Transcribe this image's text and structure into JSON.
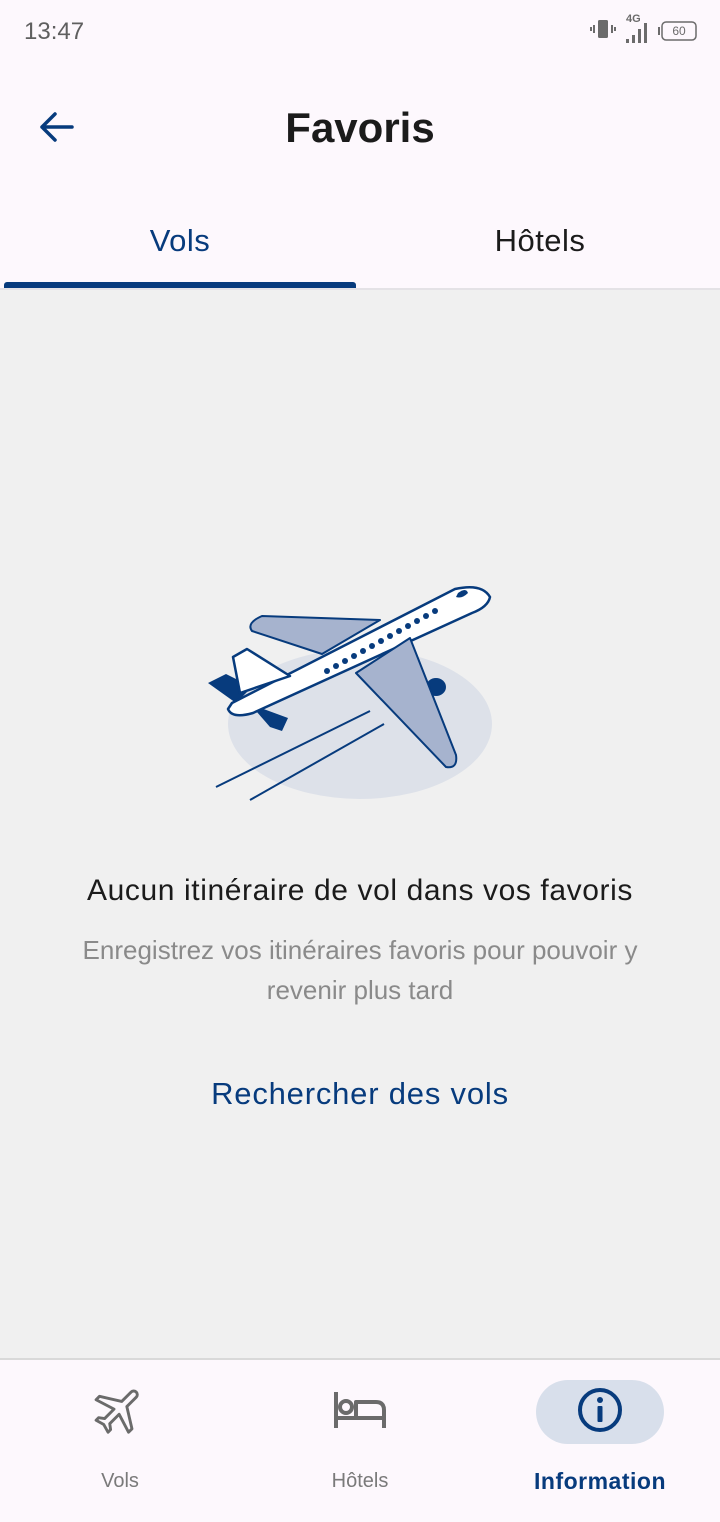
{
  "status_bar": {
    "time": "13:47",
    "network": "4G",
    "battery": "60",
    "icons": [
      "vibrate-icon",
      "signal-icon",
      "battery-icon"
    ]
  },
  "header": {
    "title": "Favoris",
    "back_icon": "arrow-left-icon"
  },
  "tabs": [
    {
      "label": "Vols",
      "selected": true
    },
    {
      "label": "Hôtels",
      "selected": false
    }
  ],
  "empty_state": {
    "illustration": "airplane-illustration",
    "title": "Aucun itinéraire de vol dans vos favoris",
    "subtitle": "Enregistrez vos itinéraires favoris pour pouvoir y revenir plus tard",
    "action_label": "Rechercher des vols"
  },
  "bottom_nav": [
    {
      "label": "Vols",
      "icon": "airplane-icon",
      "active": false
    },
    {
      "label": "Hôtels",
      "icon": "bed-icon",
      "active": false
    },
    {
      "label": "Information",
      "icon": "info-icon",
      "active": true
    }
  ],
  "colors": {
    "primary": "#073b7d",
    "background": "#fdf8fd",
    "content_background": "#f0f0f0",
    "secondary_text": "#8a8a8a",
    "illustration_fill": "#a6b3ce"
  }
}
